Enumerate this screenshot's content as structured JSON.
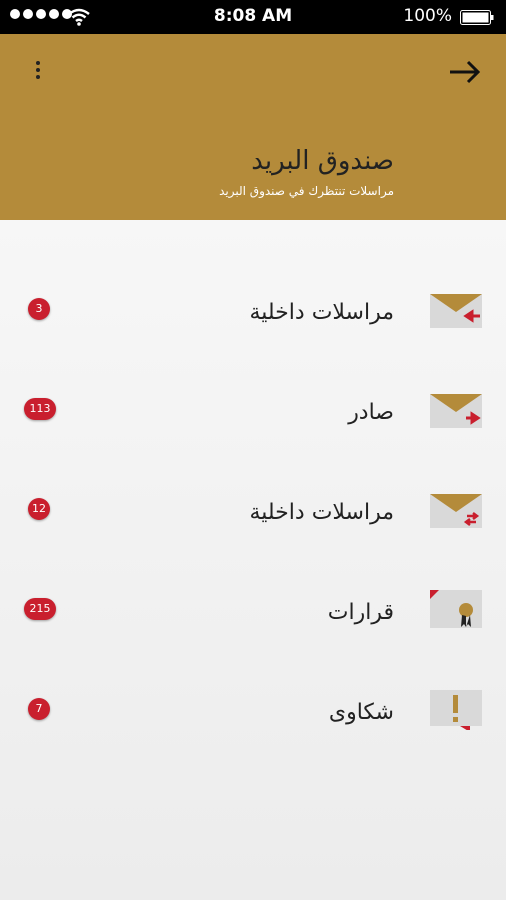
{
  "status_bar": {
    "time": "8:08 AM",
    "battery": "100%",
    "icons": [
      "signal-dots-icon",
      "wifi-icon",
      "battery-icon"
    ]
  },
  "header": {
    "title": "صندوق البريد",
    "subtitle": "مراسلات تنتظرك في صندوق البريد",
    "background": "#b48b3a",
    "menu_icon": "more-vertical-icon",
    "back_icon": "arrow-right-icon"
  },
  "items": [
    {
      "label": "مراسلات داخلية",
      "badge": "3",
      "icon": "inbox-envelope-icon"
    },
    {
      "label": "صادر",
      "badge": "113",
      "icon": "outgoing-envelope-icon"
    },
    {
      "label": "مراسلات داخلية",
      "badge": "12",
      "icon": "internal-envelope-icon"
    },
    {
      "label": "قرارات",
      "badge": "215",
      "icon": "decision-certificate-icon"
    },
    {
      "label": "شكاوى",
      "badge": "7",
      "icon": "complaint-exclamation-icon"
    }
  ],
  "colors": {
    "badge": "#c91f2e",
    "accent": "#b48b3a"
  }
}
